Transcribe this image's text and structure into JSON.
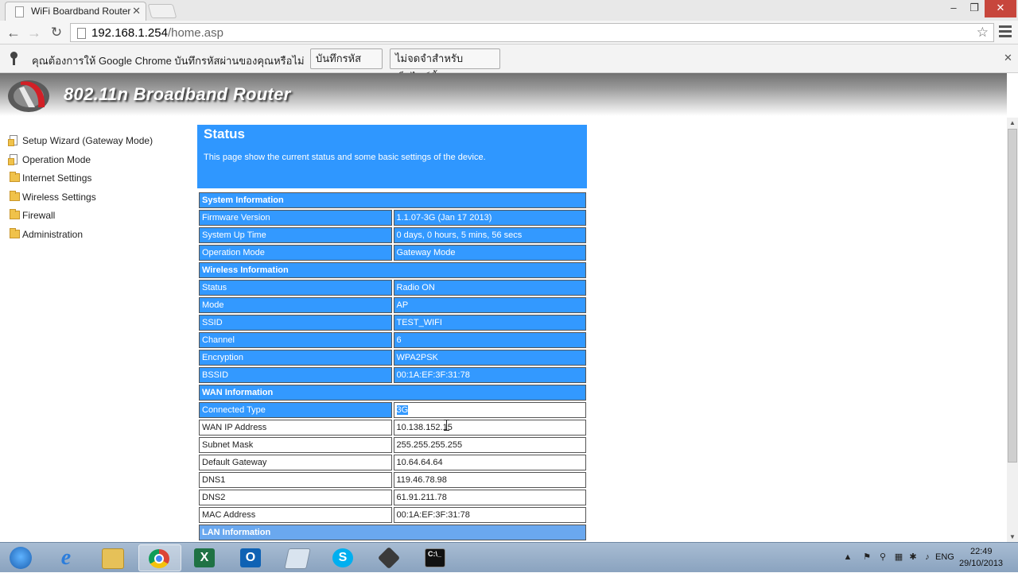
{
  "browser": {
    "tab_title": "WiFi Boardband Router",
    "url_host": "192.168.1.254",
    "url_path": "/home.asp",
    "infobar": {
      "message": "คุณต้องการให้ Google Chrome บันทึกรหัสผ่านของคุณหรือไม่",
      "save_label": "บันทึกรหัสผ่าน",
      "never_label": "ไม่จดจำสำหรับเว็บไซต์นี้"
    }
  },
  "router": {
    "banner_title": "802.11n Broadband Router",
    "nav": [
      {
        "label": "Setup Wizard (Gateway Mode)",
        "icon": "document-icon"
      },
      {
        "label": "Operation Mode",
        "icon": "document-icon"
      },
      {
        "label": "Internet Settings",
        "icon": "folder-icon"
      },
      {
        "label": "Wireless Settings",
        "icon": "folder-icon"
      },
      {
        "label": "Firewall",
        "icon": "folder-icon"
      },
      {
        "label": "Administration",
        "icon": "folder-icon"
      }
    ],
    "status": {
      "title": "Status",
      "description": "This page show the current status and some basic settings of the device.",
      "system_information": {
        "heading": "System Information",
        "rows": [
          {
            "label": "Firmware Version",
            "value": "1.1.07-3G (Jan 17 2013)"
          },
          {
            "label": "System Up Time",
            "value": "0 days, 0 hours, 5 mins, 56 secs"
          },
          {
            "label": "Operation Mode",
            "value": "Gateway Mode"
          }
        ]
      },
      "wireless_information": {
        "heading": "Wireless Information",
        "rows": [
          {
            "label": "Status",
            "value": "Radio ON"
          },
          {
            "label": "Mode",
            "value": "AP"
          },
          {
            "label": "SSID",
            "value": "TEST_WIFI"
          },
          {
            "label": "Channel",
            "value": "6"
          },
          {
            "label": "Encryption",
            "value": "WPA2PSK"
          },
          {
            "label": "BSSID",
            "value": "00:1A:EF:3F:31:78"
          }
        ]
      },
      "wan_information": {
        "heading": "WAN Information",
        "rows": [
          {
            "label": "Connected Type",
            "value": "3G"
          },
          {
            "label": "WAN IP Address",
            "value": "10.138.152.15"
          },
          {
            "label": "Subnet Mask",
            "value": "255.255.255.255"
          },
          {
            "label": "Default Gateway",
            "value": "10.64.64.64"
          },
          {
            "label": "DNS1",
            "value": "119.46.78.98"
          },
          {
            "label": "DNS2",
            "value": "61.91.211.78"
          },
          {
            "label": "MAC Address",
            "value": "00:1A:EF:3F:31:78"
          }
        ]
      },
      "lan_information": {
        "heading": "LAN Information"
      }
    }
  },
  "taskbar": {
    "apps": [
      "start",
      "internet-explorer",
      "file-explorer",
      "chrome",
      "excel",
      "outlook",
      "notepad",
      "skype",
      "tool",
      "command-prompt"
    ],
    "language": "ENG",
    "time": "22:49",
    "date": "29/10/2013"
  },
  "colors": {
    "selection_blue": "#3399ff",
    "header_blue": "#2f97ff",
    "close_red": "#c7463c"
  }
}
